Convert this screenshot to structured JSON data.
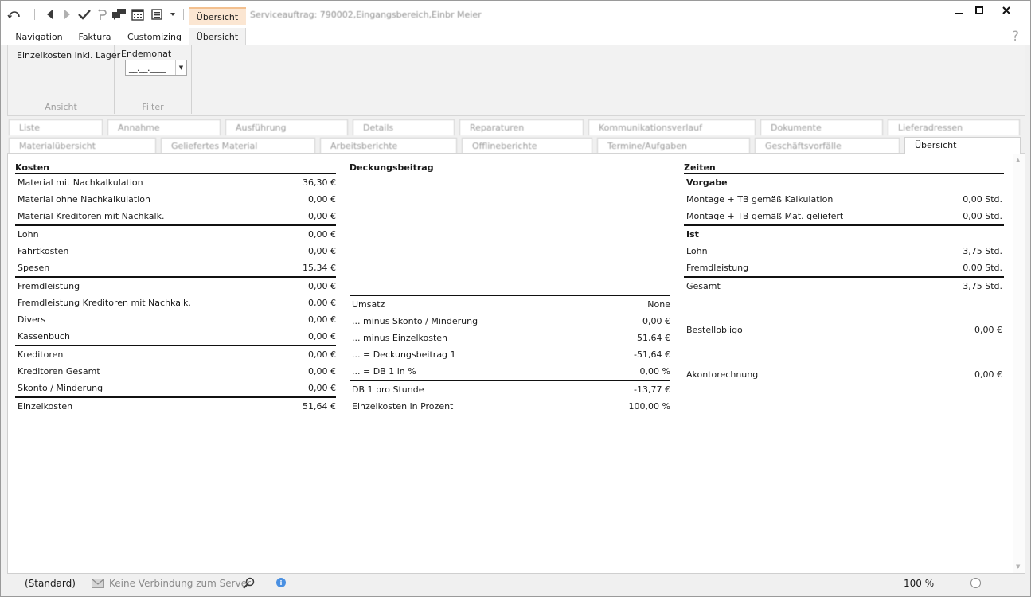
{
  "titlebar": {
    "context_tab": "Übersicht",
    "window_title": "Serviceauftrag: 790002,Eingangsbereich,Einbr Meier"
  },
  "ribbon_tabs": [
    {
      "label": "Navigation"
    },
    {
      "label": "Faktura"
    },
    {
      "label": "Customizing"
    },
    {
      "label": "Übersicht"
    }
  ],
  "help_label": "?",
  "ribbon": {
    "view_group": {
      "button": "Einzelkosten inkl. Lager",
      "caption": "Ansicht"
    },
    "filter_group": {
      "label": "Endemonat",
      "value": "__.__.____",
      "caption": "Filter"
    }
  },
  "doc_tabs_row1": [
    {
      "label": "Liste"
    },
    {
      "label": "Annahme"
    },
    {
      "label": "Ausführung"
    },
    {
      "label": "Details"
    },
    {
      "label": "Reparaturen"
    },
    {
      "label": "Kommunikationsverlauf"
    },
    {
      "label": "Dokumente"
    },
    {
      "label": "Lieferadressen"
    }
  ],
  "doc_tabs_row2": [
    {
      "label": "Materialübersicht"
    },
    {
      "label": "Geliefertes Material"
    },
    {
      "label": "Arbeitsberichte"
    },
    {
      "label": "Offlineberichte"
    },
    {
      "label": "Termine/Aufgaben"
    },
    {
      "label": "Geschäftsvorfälle"
    },
    {
      "label": "Übersicht"
    }
  ],
  "kosten": {
    "title": "Kosten",
    "rows": [
      {
        "label": "Material mit Nachkalkulation",
        "value": "36,30 €"
      },
      {
        "label": "Material ohne Nachkalkulation",
        "value": "0,00 €"
      },
      {
        "label": "Material Kreditoren mit Nachkalk.",
        "value": "0,00 €"
      },
      {
        "label": "Lohn",
        "value": "0,00 €"
      },
      {
        "label": "Fahrtkosten",
        "value": "0,00 €"
      },
      {
        "label": "Spesen",
        "value": "15,34 €"
      },
      {
        "label": "Fremdleistung",
        "value": "0,00 €"
      },
      {
        "label": "Fremdleistung Kreditoren mit Nachkalk.",
        "value": "0,00 €"
      },
      {
        "label": "Divers",
        "value": "0,00 €"
      },
      {
        "label": "Kassenbuch",
        "value": "0,00 €"
      },
      {
        "label": "Kreditoren",
        "value": "0,00 €"
      },
      {
        "label": "Kreditoren Gesamt",
        "value": "0,00 €"
      },
      {
        "label": "Skonto / Minderung",
        "value": "0,00 €"
      },
      {
        "label": "Einzelkosten",
        "value": "51,64 €"
      }
    ]
  },
  "deckungsbeitrag": {
    "title": "Deckungsbeitrag",
    "rows": [
      {
        "label": "Umsatz",
        "value": "None"
      },
      {
        "label": "... minus Skonto / Minderung",
        "value": "0,00 €"
      },
      {
        "label": "... minus Einzelkosten",
        "value": "51,64 €"
      },
      {
        "label": "... = Deckungsbeitrag 1",
        "value": "-51,64 €"
      },
      {
        "label": "... = DB 1 in %",
        "value": "0,00 %"
      },
      {
        "label": "DB 1 pro Stunde",
        "value": "-13,77 €"
      },
      {
        "label": "Einzelkosten in Prozent",
        "value": "100,00 %"
      }
    ]
  },
  "zeiten": {
    "title": "Zeiten",
    "rows": [
      {
        "label": "Vorgabe",
        "value": ""
      },
      {
        "label": "Montage + TB gemäß Kalkulation",
        "value": "0,00 Std."
      },
      {
        "label": "Montage + TB gemäß Mat. geliefert",
        "value": "0,00 Std."
      },
      {
        "label": "Ist",
        "value": ""
      },
      {
        "label": "Lohn",
        "value": "3,75 Std."
      },
      {
        "label": "Fremdleistung",
        "value": "0,00 Std."
      },
      {
        "label": "Gesamt",
        "value": "3,75 Std."
      },
      {
        "label": "Bestellobligo",
        "value": "0,00 €"
      },
      {
        "label": "Akontorechnung",
        "value": "0,00 €"
      }
    ]
  },
  "statusbar": {
    "profile": "(Standard)",
    "connection": "Keine Verbindung zum Server",
    "zoom": "100 %",
    "zoom_level": 0.5
  },
  "colors": {
    "accent_tab": "#fbe6d2",
    "info": "#4a90e2"
  }
}
